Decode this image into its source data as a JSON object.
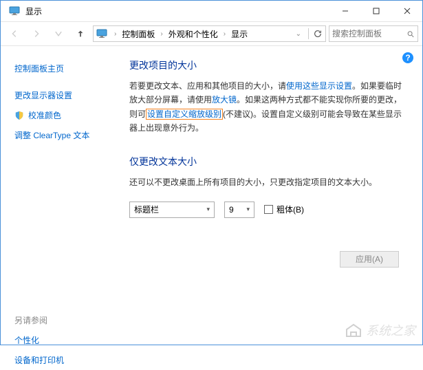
{
  "titlebar": {
    "title": "显示"
  },
  "breadcrumb": {
    "items": [
      "控制面板",
      "外观和个性化",
      "显示"
    ]
  },
  "search": {
    "placeholder": "搜索控制面板"
  },
  "sidebar": {
    "home": "控制面板主页",
    "items": [
      "更改显示器设置",
      "校准颜色",
      "调整 ClearType 文本"
    ],
    "see_also_heading": "另请参阅",
    "see_also": [
      "个性化",
      "设备和打印机"
    ]
  },
  "main": {
    "heading1": "更改项目的大小",
    "para1_a": "若要更改文本、应用和其他项目的大小，请",
    "link1": "使用这些显示设置",
    "para1_b": "。如果要临时放大部分屏幕，请使用",
    "link2": "放大镜",
    "para1_c": "。如果这两种方式都不能实现你所要的更改，则可",
    "link3": "设置自定义缩放级别",
    "para1_d": "(不建议)。设置自定义级别可能会导致在某些显示器上出现意外行为。",
    "heading2": "仅更改文本大小",
    "para2": "还可以不更改桌面上所有项目的大小，只更改指定项目的文本大小。",
    "select_item": "标题栏",
    "select_size": "9",
    "bold_label": "粗体(B)",
    "apply": "应用(A)"
  },
  "watermark": "系统之家"
}
